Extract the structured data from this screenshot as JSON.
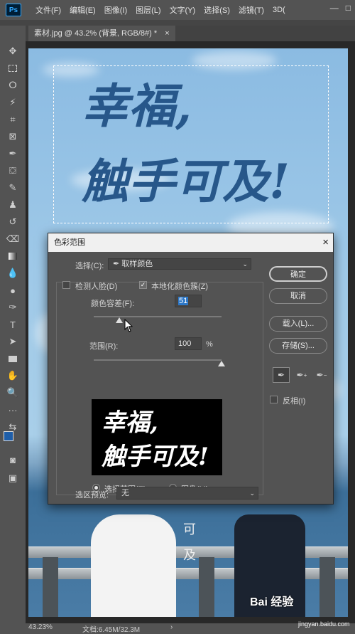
{
  "app": {
    "logo": "Ps"
  },
  "menubar": {
    "items": [
      "文件(F)",
      "编辑(E)",
      "图像(I)",
      "图层(L)",
      "文字(Y)",
      "选择(S)",
      "滤镜(T)",
      "3D("
    ],
    "window_controls": [
      "—",
      "□"
    ]
  },
  "document": {
    "tab_title": "素材.jpg @ 43.2% (背景, RGB/8#) *",
    "tab_close": "×"
  },
  "canvas": {
    "calligraphy_line1": "幸福,",
    "calligraphy_line2": "触手可及!",
    "overlay_char1": "可",
    "overlay_char2": "及"
  },
  "status": {
    "zoom": "43.23%",
    "doc": "文档:6.45M/32.3M",
    "arrow": "›"
  },
  "watermark": {
    "brand": "Bai  经验",
    "url": "jingyan.baidu.com"
  },
  "dialog": {
    "title": "色彩范围",
    "close": "×",
    "select_label": "选择(C):",
    "select_value": "取样颜色",
    "detect_faces_label": "检测人脸(D)",
    "detect_faces_checked": false,
    "localized_label": "本地化颜色簇(Z)",
    "localized_checked": true,
    "fuzziness_label": "颜色容差(F):",
    "fuzziness_value": "51",
    "fuzziness_level": 0.2,
    "range_label": "范围(R):",
    "range_value": "100",
    "range_unit": "%",
    "range_level": 1.0,
    "preview_text_line1": "幸福,",
    "preview_text_line2": "触手可及!",
    "radio_selection": "选择范围(E)",
    "radio_image": "图像(M)",
    "radio_selected": "selection",
    "selection_preview_label": "选区预览:",
    "selection_preview_value": "无",
    "buttons": {
      "ok": "确定",
      "cancel": "取消",
      "load": "载入(L)...",
      "save": "存储(S)..."
    },
    "invert_label": "反相(I)",
    "invert_checked": false
  }
}
